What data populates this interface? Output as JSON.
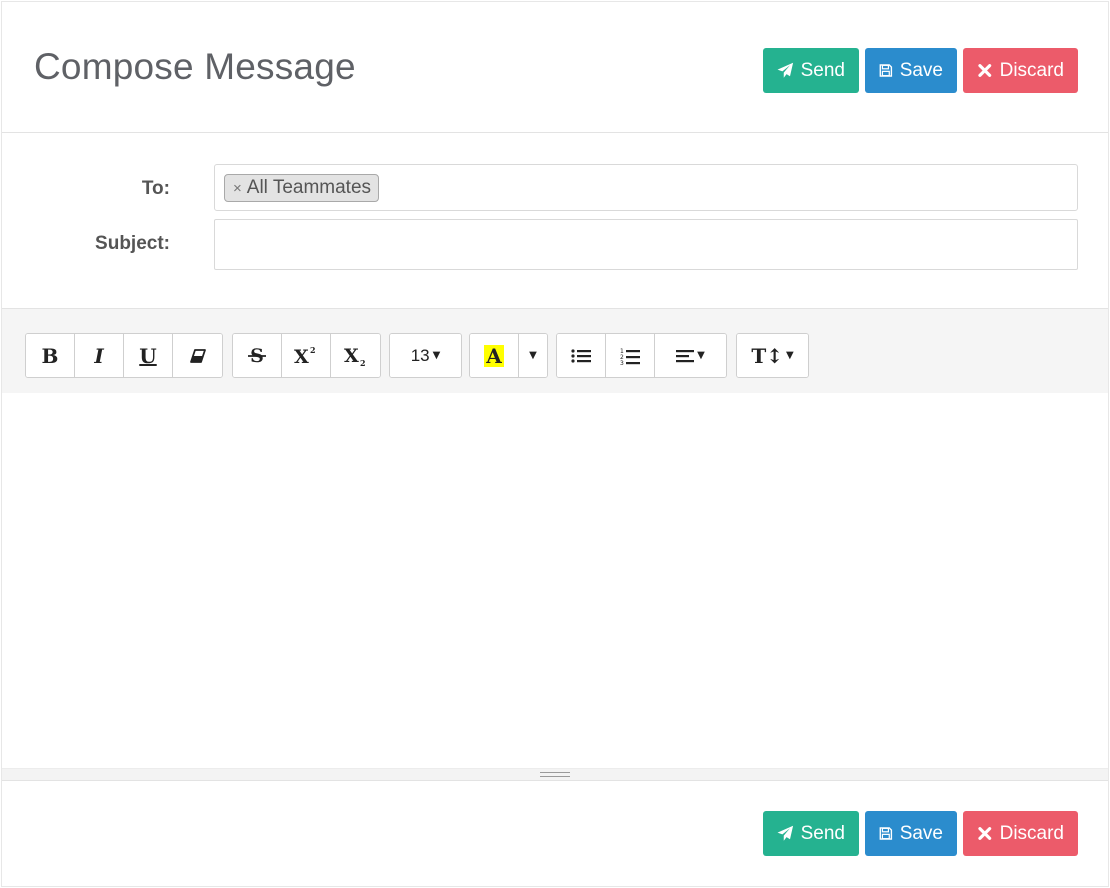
{
  "page": {
    "title": "Compose Message"
  },
  "actions": {
    "send_label": "Send",
    "save_label": "Save",
    "discard_label": "Discard"
  },
  "fields": {
    "to_label": "To:",
    "subject_label": "Subject:",
    "subject_value": "",
    "recipients": [
      "All Teammates"
    ],
    "remove_symbol": "×"
  },
  "toolbar": {
    "bold": "B",
    "italic": "I",
    "underline": "U",
    "font_size": "13",
    "highlight_letter": "A",
    "highlight_color": "#ffff00",
    "text_size": "T↕"
  },
  "colors": {
    "send": "#25b290",
    "save": "#2b8ccd",
    "discard": "#ec5b6a"
  },
  "icons": {
    "send": "paper-plane-icon",
    "save": "floppy-disk-icon",
    "discard": "close-icon",
    "eraser": "eraser-icon",
    "strikethrough": "strikethrough-icon",
    "superscript": "superscript-icon",
    "subscript": "subscript-icon",
    "unordered_list": "unordered-list-icon",
    "ordered_list": "ordered-list-icon",
    "align": "align-left-icon",
    "resize": "resize-grip-icon"
  }
}
